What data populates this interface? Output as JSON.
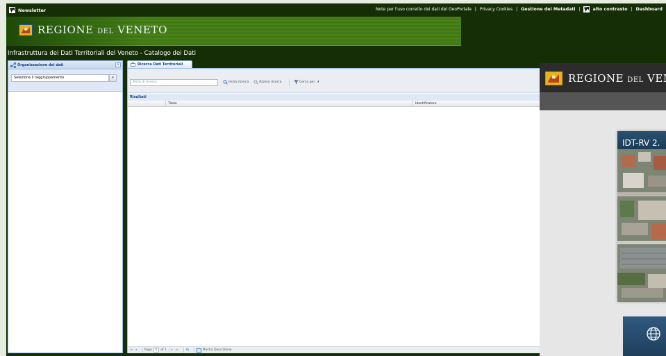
{
  "topbar": {
    "newsletter": "Newsletter",
    "links": [
      {
        "label": "Note per l'uso corretto dei dati del GeoPortale"
      },
      {
        "label": "Privacy Cookies"
      },
      {
        "label": "Gestione dei Metadati"
      },
      {
        "label": "alto contrasto"
      },
      {
        "label": "Dashboard"
      }
    ],
    "separator": "|"
  },
  "banner": {
    "logo_main": "REGIONE ",
    "logo_small": "DEL",
    "logo_end": " VENETO"
  },
  "catalog_title": "Infrastruttura dei Dati Territoriali del Veneto - Catalogo dei Dati",
  "left_panel": {
    "title": "Organizzazione dei dati",
    "collapse": "«",
    "combo_value": "Seleziona il raggruppamento",
    "combo_arrow": "▾"
  },
  "center": {
    "tab_label": "Ricerca Dati Territoriali",
    "search_placeholder": "Testo di ricerca",
    "start_search": "Inizia ricerca",
    "reset_search": "Azzera ricerca",
    "search_by": "Cerca per...",
    "search_by_arrow": "▾",
    "results": "Risultati",
    "columns": [
      "Titolo",
      "Identificatore"
    ],
    "pager": {
      "first": "|◂",
      "prev": "◂",
      "page": "Page",
      "page_value": "1",
      "of": "of 1",
      "next": "▸",
      "last": "▸|",
      "refresh": "↻",
      "show_description": "Mostra Descrizione"
    }
  },
  "overlay": {
    "logo_main": "REGIONE ",
    "logo_small": "DEL",
    "logo_end": " VEN",
    "card_title": "IDT-RV 2."
  },
  "colors": {
    "frame": "#152e05",
    "banner": "#4a8419",
    "panel_header": "#dfe8f6",
    "accent_text": "#15428b"
  }
}
